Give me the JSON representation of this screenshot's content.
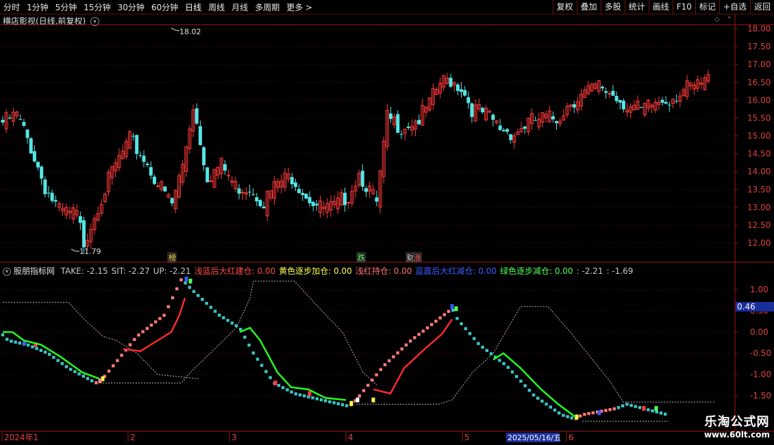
{
  "toolbar": {
    "periods": [
      "分时",
      "1分钟",
      "5分钟",
      "15分钟",
      "30分钟",
      "60分钟",
      "日线",
      "周线",
      "月线",
      "多周期",
      "更多"
    ],
    "more_arrow": ">",
    "actions": [
      "复权",
      "叠加",
      "多股",
      "统计",
      "画线",
      "F10",
      "标记",
      "+自选",
      "返回"
    ]
  },
  "main_panel": {
    "title": "横店影视(日线,前复权)",
    "high_label": "18.02",
    "low_label": "11.79",
    "price_ticks": [
      "18.00",
      "17.50",
      "17.00",
      "16.50",
      "16.00",
      "15.50",
      "15.00",
      "14.50",
      "14.00",
      "13.50",
      "13.00",
      "12.50",
      "12.00"
    ],
    "markers": [
      {
        "text": "榜",
        "color": "#ffd24a"
      },
      {
        "text": "跌",
        "color": "#66ff66"
      },
      {
        "text": "财",
        "color": "#e0e0e0"
      },
      {
        "text": "涨",
        "color": "#ff6060"
      }
    ]
  },
  "indicator_panel": {
    "name": "股朋指标网",
    "fields": [
      {
        "label": "TAKE: -2.15",
        "color": "#c8c8c8"
      },
      {
        "label": "SIT: -2.27",
        "color": "#c8c8c8"
      },
      {
        "label": "UP: -2.21",
        "color": "#c8c8c8"
      },
      {
        "label": "浅蓝后大红建仓: 0.00",
        "color": "#ff4a4a"
      },
      {
        "label": "黄色逐步加仓: 0.00",
        "color": "#ffff55"
      },
      {
        "label": "浅红持仓: 0.00",
        "color": "#ff7070"
      },
      {
        "label": "蓝震后大红减仓: 0.00",
        "color": "#3a5cff"
      },
      {
        "label": "绿色逐步减仓: 0.00",
        "color": "#55ff55"
      },
      {
        "label": ": -2.21",
        "color": "#c8c8c8"
      },
      {
        "label": ": -1.69",
        "color": "#c8c8c8"
      }
    ],
    "value_ticks": [
      "1.00",
      "0.50",
      "0.00",
      "-0.50",
      "-1.00",
      "-1.50"
    ],
    "current_value": "0.46"
  },
  "time_axis": {
    "labels": [
      "2024年1",
      "2",
      "3",
      "4",
      "5",
      "6"
    ],
    "cursor_date": "2025/05/16/五"
  },
  "watermark": {
    "line1": "乐淘公式网",
    "line2": "www.60lt.com"
  },
  "colors": {
    "up": "#ff3b3b",
    "down": "#54e6e6",
    "grid": "#5a1010",
    "axis": "#a01818"
  }
}
